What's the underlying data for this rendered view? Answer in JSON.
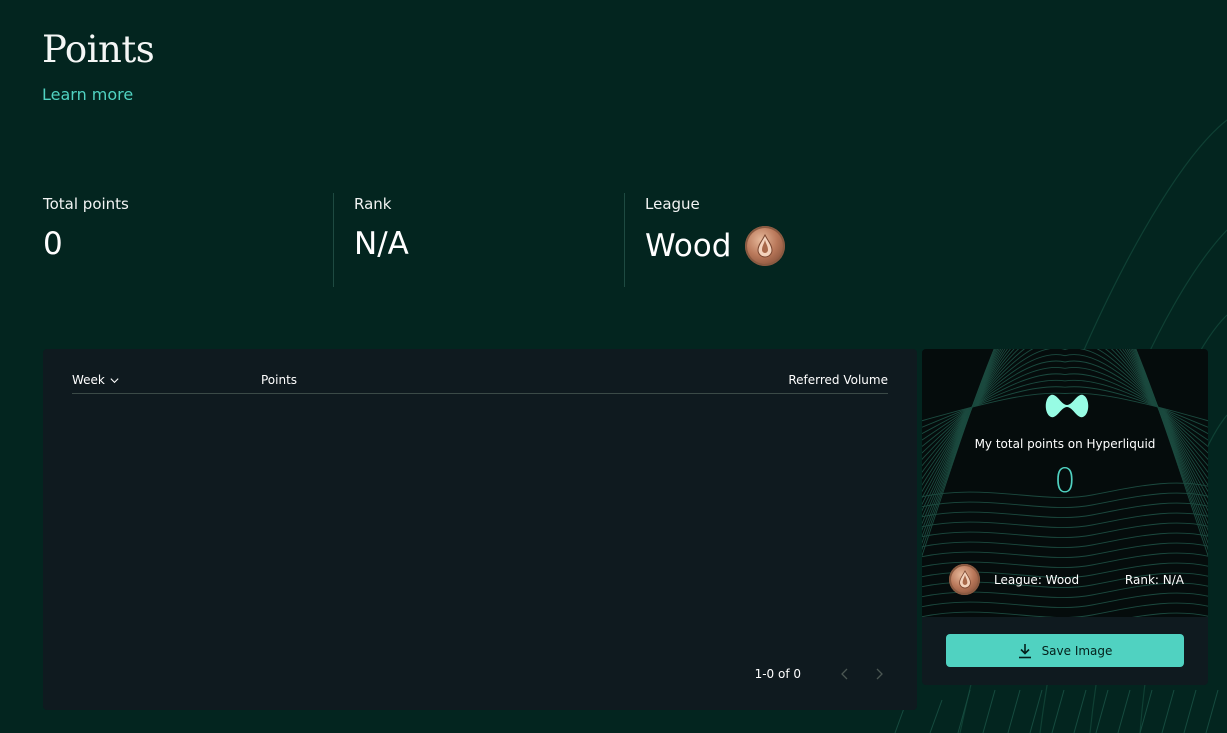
{
  "page": {
    "title": "Points",
    "learn_more": "Learn more"
  },
  "stats": {
    "total_points_label": "Total points",
    "total_points_value": "0",
    "rank_label": "Rank",
    "rank_value": "N/A",
    "league_label": "League",
    "league_value": "Wood",
    "league_icon": "wood-league-badge-icon"
  },
  "table": {
    "columns": [
      "Week",
      "Points",
      "Referred Volume"
    ],
    "rows": [],
    "pagination": {
      "range": "1-0 of 0"
    }
  },
  "share_card": {
    "caption": "My total points on Hyperliquid",
    "points": "0",
    "league": "League: Wood",
    "rank": "Rank: N/A",
    "save_label": "Save Image"
  },
  "colors": {
    "background": "#03251f",
    "card": "#0f1a1f",
    "accent": "#50d2c1",
    "badge_wood": "#b9785a"
  }
}
